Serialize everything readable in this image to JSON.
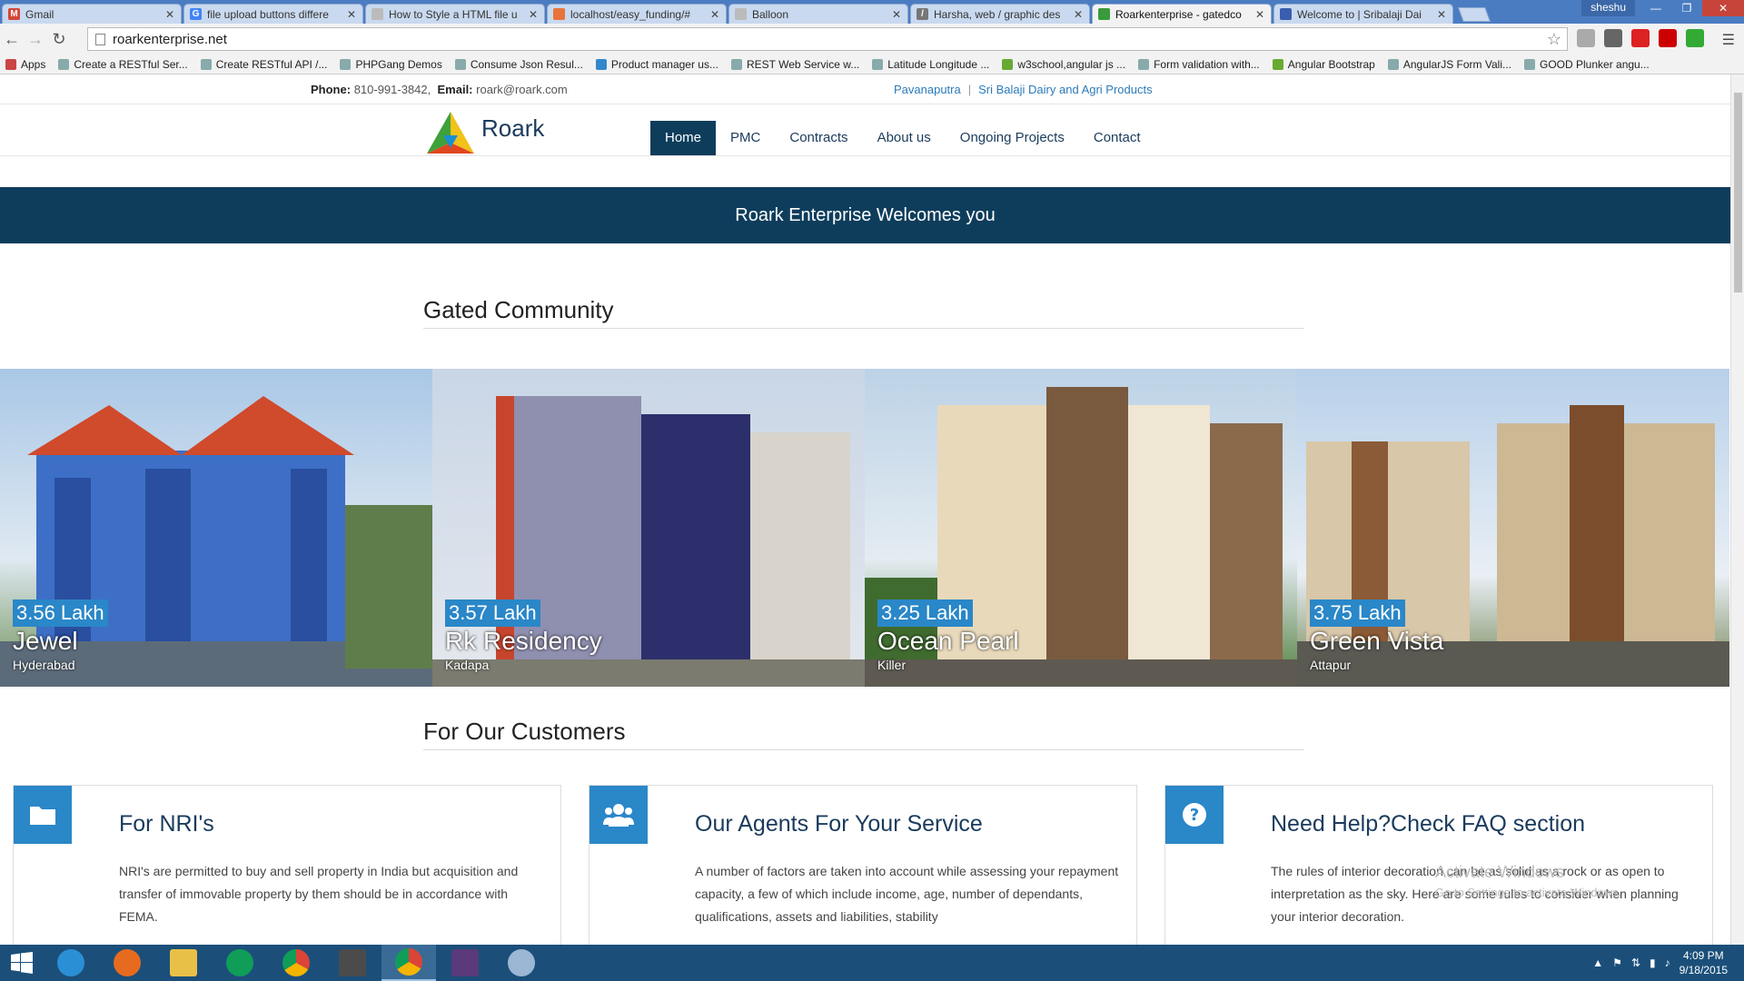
{
  "browser": {
    "tabs": [
      {
        "title": "Gmail",
        "icon": "gmail-icon",
        "color": "#d44638"
      },
      {
        "title": "file upload buttons differe",
        "icon": "google-icon",
        "color": "#4285f4"
      },
      {
        "title": "How to Style a HTML file u",
        "icon": "page-icon",
        "color": "#999999"
      },
      {
        "title": "localhost/easy_funding/#",
        "icon": "localhost-icon",
        "color": "#e8743b"
      },
      {
        "title": "Balloon",
        "icon": "page-icon",
        "color": "#999999"
      },
      {
        "title": "Harsha, web / graphic des",
        "icon": "slash-icon",
        "color": "#777777"
      },
      {
        "title": "Roarkenterprise - gatedco",
        "icon": "roark-icon",
        "color": "#3a9b3a"
      },
      {
        "title": "Welcome to | Sribalaji Dai",
        "icon": "sribalaji-icon",
        "color": "#3b5db0"
      }
    ],
    "user": "sheshu",
    "url": "roarkenterprise.net",
    "bookmarks": [
      "Apps",
      "Create a RESTful Ser...",
      "Create RESTful API /...",
      "PHPGang Demos",
      "Consume Json Resul...",
      "Product manager us...",
      "REST Web Service w...",
      "Latitude Longitude ...",
      "w3school,angular js ...",
      "Form validation with...",
      "Angular Bootstrap",
      "AngularJS Form Vali...",
      "GOOD Plunker angu..."
    ]
  },
  "site": {
    "phone_label": "Phone:",
    "phone": "810-991-3842,",
    "email_label": "Email:",
    "email": "roark@roark.com",
    "toplinks": [
      "Pavanaputra",
      "Sri Balaji Dairy and Agri Products"
    ],
    "brand": "Roark",
    "nav": [
      "Home",
      "PMC",
      "Contracts",
      "About us",
      "Ongoing Projects",
      "Contact"
    ],
    "banner": "Roark Enterprise Welcomes you",
    "gated_title": "Gated Community",
    "properties": [
      {
        "price": "3.56 Lakh",
        "name": "Jewel",
        "location": "Hyderabad"
      },
      {
        "price": "3.57 Lakh",
        "name": "Rk Residency",
        "location": "Kadapa"
      },
      {
        "price": "3.25 Lakh",
        "name": "Ocean Pearl",
        "location": "Killer"
      },
      {
        "price": "3.75 Lakh",
        "name": "Green Vista",
        "location": "Attapur"
      }
    ],
    "customers_title": "For Our Customers",
    "features": [
      {
        "title": "For NRI's",
        "icon": "folder-icon",
        "text": "NRI's are permitted to buy and sell property in India but acquisition and transfer of immovable property by them should be in accordance with FEMA."
      },
      {
        "title": "Our Agents For Your Service",
        "icon": "users-icon",
        "text": "A number of factors are taken into account while assessing your repayment capacity, a few of which include income, age, number of dependants, qualifications, assets and liabilities, stability"
      },
      {
        "title": "Need Help?Check FAQ section",
        "icon": "question-icon",
        "text": "The rules of interior decoration can be as solid as a rock or as open to interpretation as the sky. Here are some rules to consider when planning your interior decoration."
      }
    ],
    "watermark": "Activate Windows",
    "watermark_sub": "Go to Settings to activate Windows."
  },
  "taskbar": {
    "time": "4:09 PM",
    "date": "9/18/2015"
  },
  "colors": {
    "navy": "#0e3d5c",
    "accent": "#2a87c8"
  }
}
